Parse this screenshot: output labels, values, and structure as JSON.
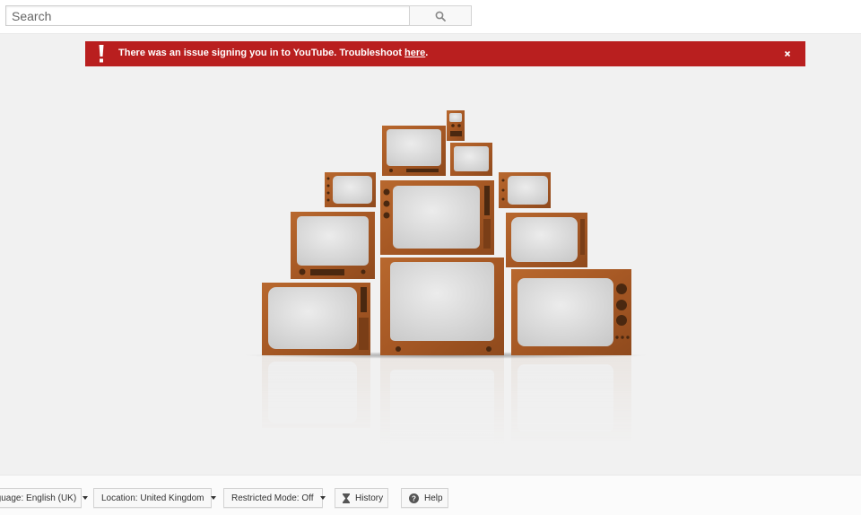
{
  "search": {
    "placeholder": "Search",
    "button_icon": "search-icon"
  },
  "alert": {
    "message": "There was an issue signing you in to YouTube. Troubleshoot ",
    "link_text": "here",
    "suffix": ".",
    "background": "#b91f1f",
    "icons": [
      "exclamation-icon",
      "close-icon"
    ]
  },
  "illustration": {
    "name": "stack of vintage televisions"
  },
  "footer": {
    "language": "Language: English (UK)",
    "location": "Location: United Kingdom",
    "restricted_mode": "Restricted Mode: Off",
    "history": "History",
    "help": "Help",
    "icons": [
      "hourglass-icon",
      "help-icon"
    ]
  },
  "colors": {
    "alert_red": "#b91f1f",
    "page_bg": "#f1f1f1",
    "tv_wood": "#a85a26"
  }
}
